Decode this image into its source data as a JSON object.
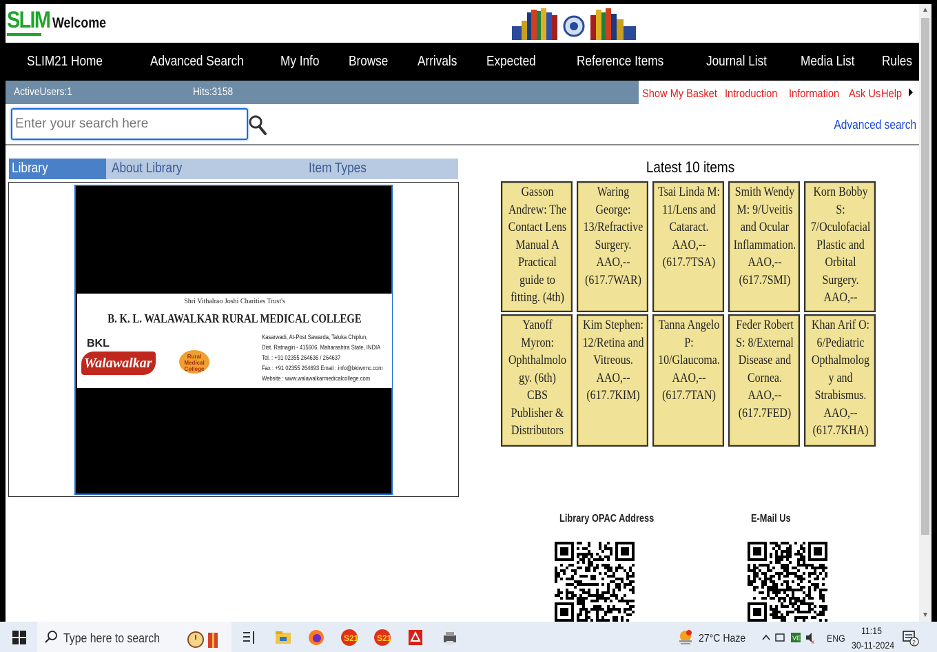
{
  "header": {
    "logo_text": "SLIM",
    "welcome": "Welcome"
  },
  "nav": {
    "items": [
      "SLIM21 Home",
      "Advanced Search",
      "My Info",
      "Browse",
      "Arrivals",
      "Expected",
      "Reference Items",
      "Journal List",
      "Media List",
      "Rules"
    ]
  },
  "status": {
    "active_users": "ActiveUsers:1",
    "hits": "Hits:3158"
  },
  "quick_links": [
    "Show My Basket",
    "Introduction",
    "Information",
    "Ask Us",
    "Help"
  ],
  "search": {
    "placeholder": "Enter your search here",
    "advanced_link": "Advanced search"
  },
  "library_tabs": [
    "Library",
    "About Library",
    "Item Types"
  ],
  "banner": {
    "trust": "Shri Vithalrao Joshi Charities Trust's",
    "college": "B. K. L. WALAWALKAR RURAL MEDICAL COLLEGE",
    "logo_bkl": "BKL",
    "logo_name": "Walawalkar",
    "logo_badge": "Rural Medical College",
    "address_lines": [
      "Kasarwadi, At-Post Sawarda, Taluka Chiplun,",
      "Dist. Ratnagiri - 415606. Maharashtra State, INDIA",
      "Tel. : +91 02355 264636 / 264637",
      "Fax : +91 02355 264693  Email : info@bkiwrmc.com",
      "Website : www.walawalkarmedicalcollege.com"
    ]
  },
  "latest": {
    "title": "Latest 10 items",
    "items": [
      [
        "Gasson",
        "Andrew: The",
        "Contact Lens",
        "Manual A",
        "Practical",
        "guide to",
        "fitting.  (4th)"
      ],
      [
        "Waring",
        "George:",
        "13/Refractive",
        "Surgery.",
        "AAO,--",
        "(617.7WAR)"
      ],
      [
        "Tsai Linda M:",
        "11/Lens and",
        "Cataract.",
        "AAO,--",
        "(617.7TSA)"
      ],
      [
        "Smith Wendy",
        "M: 9/Uveitis",
        "and Ocular",
        "Inflammation.",
        "AAO,--",
        "(617.7SMI)"
      ],
      [
        "Korn Bobby",
        "S:",
        "7/Oculofacial",
        "Plastic and",
        "Orbital",
        "Surgery.",
        "AAO,--"
      ],
      [
        "Yanoff",
        "Myron:",
        "Ophthalmolo",
        "gy.  (6th)",
        "CBS",
        "Publisher &",
        "Distributors"
      ],
      [
        "Kim Stephen:",
        "12/Retina and",
        "Vitreous.",
        "AAO,--",
        "(617.7KIM)"
      ],
      [
        "Tanna Angelo",
        "P:",
        "10/Glaucoma.",
        "AAO,--",
        "(617.7TAN)"
      ],
      [
        "Feder Robert",
        "S: 8/External",
        "Disease and",
        "Cornea.",
        "AAO,--",
        "(617.7FED)"
      ],
      [
        "Khan Arif O:",
        "6/Pediatric",
        "Opthalmolog",
        "y and",
        "Strabismus.",
        "AAO,--",
        "(617.7KHA)"
      ]
    ]
  },
  "qr": {
    "opac_label": "Library OPAC Address",
    "email_label": "E-Mail Us"
  },
  "taskbar": {
    "search_text": "Type here to search",
    "weather": "27°C  Haze",
    "lang": "ENG",
    "time": "11:15",
    "date": "30-11-2024",
    "notif_count": "2"
  },
  "colors": {
    "nav_bg": "#000000",
    "status_bg": "#6e8ca5",
    "quick_link": "#e31a1a",
    "item_bg": "#f0e296",
    "logo_green": "#1fa52b"
  }
}
